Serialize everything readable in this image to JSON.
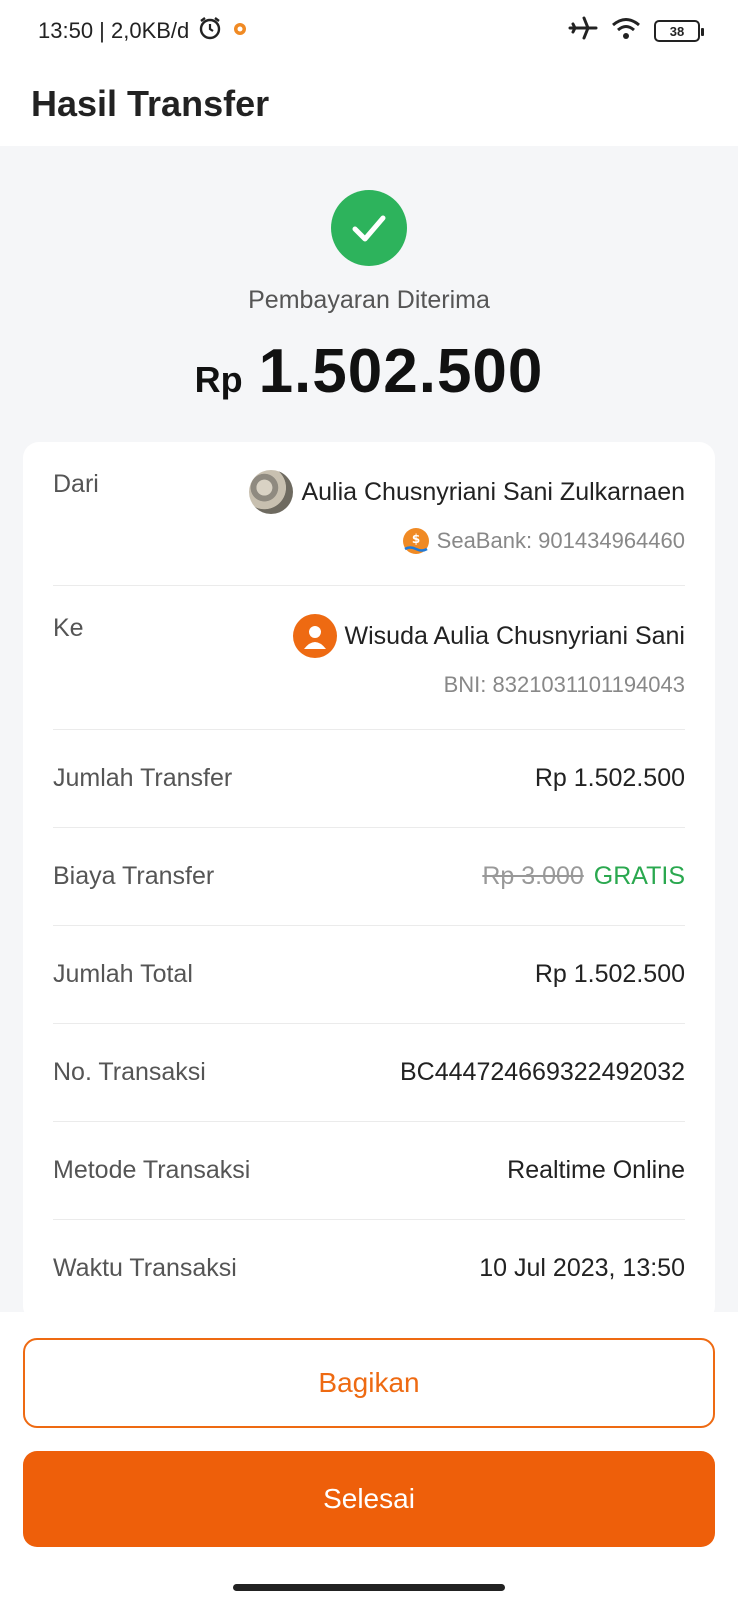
{
  "status_bar": {
    "time_speed": "13:50 | 2,0KB/d",
    "battery": "38"
  },
  "header": {
    "title": "Hasil Transfer"
  },
  "hero": {
    "status": "Pembayaran Diterima",
    "currency": "Rp",
    "amount": "1.502.500",
    "success_color": "#2db35c"
  },
  "details": {
    "from": {
      "label": "Dari",
      "name": "Aulia Chusnyriani Sani Zulkarnaen",
      "account": "SeaBank: 901434964460"
    },
    "to": {
      "label": "Ke",
      "name": "Wisuda Aulia Chusnyriani Sani",
      "account": "BNI: 8321031101194043"
    },
    "rows": [
      {
        "label": "Jumlah Transfer",
        "value": "Rp 1.502.500"
      },
      {
        "label": "Biaya Transfer",
        "strike": "Rp 3.000",
        "value": "GRATIS"
      },
      {
        "label": "Jumlah Total",
        "value": "Rp 1.502.500"
      },
      {
        "label": "No. Transaksi",
        "value": "BC444724669322492032"
      },
      {
        "label": "Metode Transaksi",
        "value": "Realtime Online"
      },
      {
        "label": "Waktu Transaksi",
        "value": "10 Jul 2023, 13:50"
      }
    ]
  },
  "actions": {
    "share_label": "Bagikan",
    "done_label": "Selesai",
    "accent_color": "#ee5f0a"
  }
}
